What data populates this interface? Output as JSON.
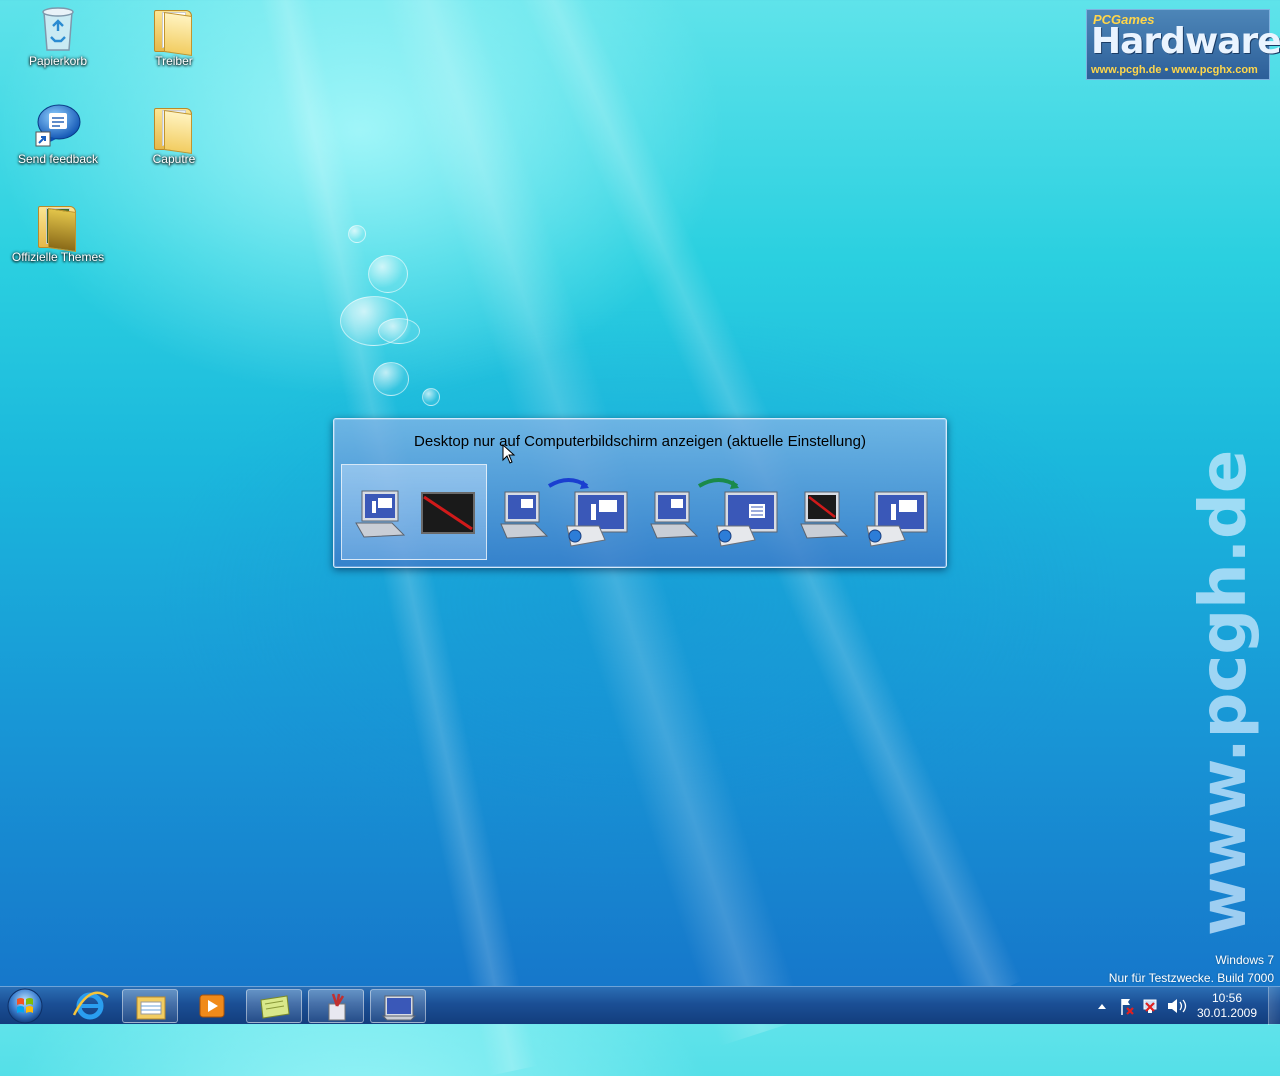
{
  "desktop": {
    "icons": [
      {
        "label": "Papierkorb",
        "icon": "recycle-bin-icon"
      },
      {
        "label": "Treiber",
        "icon": "folder-icon"
      },
      {
        "label": "Send feedback",
        "icon": "feedback-icon"
      },
      {
        "label": "Caputre",
        "icon": "folder-icon"
      },
      {
        "label": "Offizielle Themes",
        "icon": "folder-icon"
      }
    ]
  },
  "logo": {
    "sub": "PCGames",
    "main": "Hardware",
    "url": "www.pcgh.de • www.pcghx.com"
  },
  "vertical_url": "www.pcgh.de",
  "watermark": {
    "line1": "Windows 7",
    "line2": "Nur für Testzwecke. Build 7000"
  },
  "display_switch": {
    "title": "Desktop nur auf Computerbildschirm anzeigen (aktuelle Einstellung)",
    "selected_index": 0,
    "options": [
      {
        "icon": "computer-only-icon"
      },
      {
        "icon": "duplicate-icon"
      },
      {
        "icon": "extend-icon"
      },
      {
        "icon": "projector-only-icon"
      }
    ]
  },
  "taskbar": {
    "items": [
      {
        "icon": "internet-explorer-icon"
      },
      {
        "icon": "windows-explorer-icon"
      },
      {
        "icon": "media-player-icon"
      },
      {
        "icon": "notes-icon"
      },
      {
        "icon": "paint-icon"
      },
      {
        "icon": "display-settings-icon"
      }
    ],
    "tray": [
      "show-hidden-icons-icon",
      "action-center-icon",
      "network-icon",
      "volume-icon"
    ],
    "time": "10:56",
    "date": "30.01.2009"
  },
  "colors": {
    "taskbar": "#1b4f95",
    "panel": "#3c78c8",
    "logo_accent": "#ffd64a"
  }
}
